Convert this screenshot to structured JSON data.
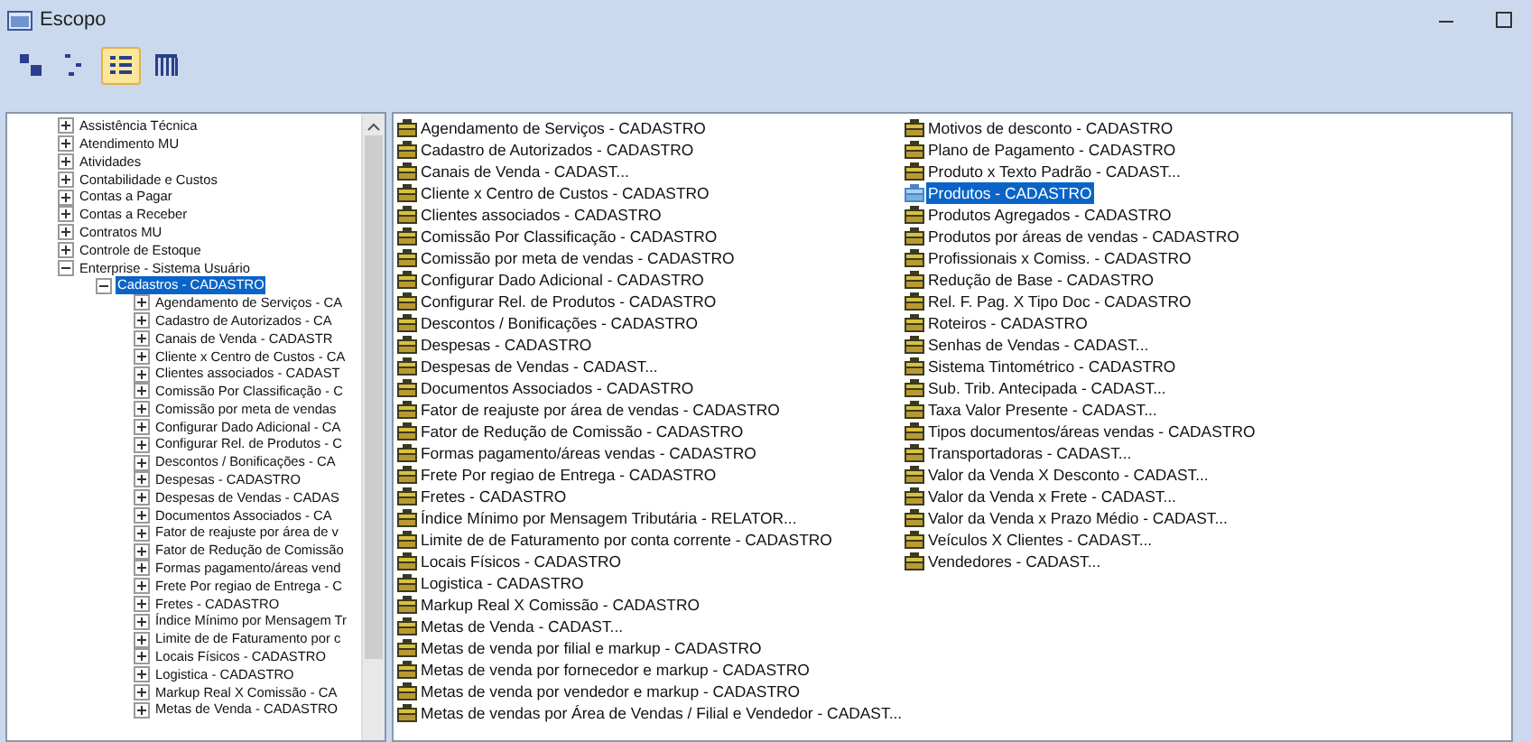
{
  "window": {
    "title": "Escopo"
  },
  "toolbar": [
    {
      "kind": "large-icons",
      "selected": false
    },
    {
      "kind": "small-icons",
      "selected": false
    },
    {
      "kind": "list",
      "selected": true
    },
    {
      "kind": "details",
      "selected": false
    }
  ],
  "tree": [
    {
      "label": "Assistência Técnica",
      "expanded": false,
      "selected": false
    },
    {
      "label": "Atendimento MU",
      "expanded": false,
      "selected": false
    },
    {
      "label": "Atividades",
      "expanded": false,
      "selected": false
    },
    {
      "label": "Contabilidade e Custos",
      "expanded": false,
      "selected": false
    },
    {
      "label": "Contas a Pagar",
      "expanded": false,
      "selected": false
    },
    {
      "label": "Contas a Receber",
      "expanded": false,
      "selected": false
    },
    {
      "label": "Contratos MU",
      "expanded": false,
      "selected": false
    },
    {
      "label": "Controle de Estoque",
      "expanded": false,
      "selected": false
    },
    {
      "label": "Enterprise - Sistema Usuário",
      "expanded": true,
      "selected": false,
      "children": [
        {
          "label": "Cadastros - CADASTRO",
          "expanded": true,
          "selected": true,
          "children": [
            {
              "label": "Agendamento de Serviços - CA",
              "expanded": false,
              "selected": false
            },
            {
              "label": "Cadastro de Autorizados - CA",
              "expanded": false,
              "selected": false
            },
            {
              "label": "Canais de Venda - CADASTR",
              "expanded": false,
              "selected": false
            },
            {
              "label": "Cliente x Centro de Custos - CA",
              "expanded": false,
              "selected": false
            },
            {
              "label": "Clientes associados - CADAST",
              "expanded": false,
              "selected": false
            },
            {
              "label": "Comissão Por Classificação - C",
              "expanded": false,
              "selected": false
            },
            {
              "label": "Comissão por meta de vendas",
              "expanded": false,
              "selected": false
            },
            {
              "label": "Configurar Dado Adicional - CA",
              "expanded": false,
              "selected": false
            },
            {
              "label": "Configurar Rel. de Produtos - C",
              "expanded": false,
              "selected": false
            },
            {
              "label": "Descontos / Bonificações - CA",
              "expanded": false,
              "selected": false
            },
            {
              "label": "Despesas - CADASTRO",
              "expanded": false,
              "selected": false
            },
            {
              "label": "Despesas de Vendas - CADAS",
              "expanded": false,
              "selected": false
            },
            {
              "label": "Documentos Associados - CA",
              "expanded": false,
              "selected": false
            },
            {
              "label": "Fator de reajuste por área de v",
              "expanded": false,
              "selected": false
            },
            {
              "label": "Fator de Redução de Comissão",
              "expanded": false,
              "selected": false
            },
            {
              "label": "Formas pagamento/áreas vend",
              "expanded": false,
              "selected": false
            },
            {
              "label": "Frete Por regiao de Entrega - C",
              "expanded": false,
              "selected": false
            },
            {
              "label": "Fretes - CADASTRO",
              "expanded": false,
              "selected": false
            },
            {
              "label": "Índice Mínimo por Mensagem Tr",
              "expanded": false,
              "selected": false
            },
            {
              "label": "Limite de de Faturamento por c",
              "expanded": false,
              "selected": false
            },
            {
              "label": "Locais Físicos - CADASTRO",
              "expanded": false,
              "selected": false
            },
            {
              "label": "Logistica - CADASTRO",
              "expanded": false,
              "selected": false
            },
            {
              "label": "Markup Real X Comissão - CA",
              "expanded": false,
              "selected": false
            },
            {
              "label": "Metas de Venda - CADASTRO",
              "expanded": false,
              "selected": false
            }
          ]
        }
      ]
    }
  ],
  "items": [
    {
      "label": "Agendamento de Serviços - CADASTRO",
      "selected": false
    },
    {
      "label": "Cadastro de Autorizados - CADASTRO",
      "selected": false
    },
    {
      "label": "Canais de Venda - CADAST...",
      "selected": false
    },
    {
      "label": "Cliente x Centro de Custos - CADASTRO",
      "selected": false
    },
    {
      "label": "Clientes associados - CADASTRO",
      "selected": false
    },
    {
      "label": "Comissão Por Classificação - CADASTRO",
      "selected": false
    },
    {
      "label": "Comissão por meta de vendas - CADASTRO",
      "selected": false
    },
    {
      "label": "Configurar Dado Adicional - CADASTRO",
      "selected": false
    },
    {
      "label": "Configurar Rel. de Produtos - CADASTRO",
      "selected": false
    },
    {
      "label": "Descontos / Bonificações - CADASTRO",
      "selected": false
    },
    {
      "label": "Despesas - CADASTRO",
      "selected": false
    },
    {
      "label": "Despesas de Vendas - CADAST...",
      "selected": false
    },
    {
      "label": "Documentos Associados - CADASTRO",
      "selected": false
    },
    {
      "label": "Fator de reajuste por área de vendas - CADASTRO",
      "selected": false
    },
    {
      "label": "Fator de Redução de Comissão - CADASTRO",
      "selected": false
    },
    {
      "label": "Formas pagamento/áreas vendas - CADASTRO",
      "selected": false
    },
    {
      "label": "Frete Por regiao de Entrega - CADASTRO",
      "selected": false
    },
    {
      "label": "Fretes - CADASTRO",
      "selected": false
    },
    {
      "label": "Índice Mínimo por Mensagem Tributária - RELATOR...",
      "selected": false
    },
    {
      "label": "Limite de de Faturamento por conta corrente - CADASTRO",
      "selected": false
    },
    {
      "label": "Locais Físicos - CADASTRO",
      "selected": false
    },
    {
      "label": "Logistica - CADASTRO",
      "selected": false
    },
    {
      "label": "Markup Real X Comissão - CADASTRO",
      "selected": false
    },
    {
      "label": "Metas de Venda - CADAST...",
      "selected": false
    },
    {
      "label": "Metas de venda por filial e markup - CADASTRO",
      "selected": false
    },
    {
      "label": "Metas de venda por fornecedor e markup - CADASTRO",
      "selected": false
    },
    {
      "label": "Metas de venda por vendedor e markup - CADASTRO",
      "selected": false
    },
    {
      "label": "Metas de vendas por Área de Vendas / Filial e Vendedor - CADAST...",
      "selected": false
    },
    {
      "label": "Motivos de desconto - CADASTRO",
      "selected": false
    },
    {
      "label": "Plano de Pagamento - CADASTRO",
      "selected": false
    },
    {
      "label": "Produto x Texto Padrão - CADAST...",
      "selected": false
    },
    {
      "label": "Produtos - CADASTRO",
      "selected": true
    },
    {
      "label": "Produtos Agregados - CADASTRO",
      "selected": false
    },
    {
      "label": "Produtos por áreas de vendas - CADASTRO",
      "selected": false
    },
    {
      "label": "Profissionais x Comiss. - CADASTRO",
      "selected": false
    },
    {
      "label": "Redução de Base - CADASTRO",
      "selected": false
    },
    {
      "label": "Rel. F. Pag. X Tipo Doc - CADASTRO",
      "selected": false
    },
    {
      "label": "Roteiros - CADASTRO",
      "selected": false
    },
    {
      "label": "Senhas de Vendas - CADAST...",
      "selected": false
    },
    {
      "label": "Sistema Tintométrico - CADASTRO",
      "selected": false
    },
    {
      "label": "Sub. Trib. Antecipada - CADAST...",
      "selected": false
    },
    {
      "label": "Taxa Valor Presente - CADAST...",
      "selected": false
    },
    {
      "label": "Tipos documentos/áreas vendas - CADASTRO",
      "selected": false
    },
    {
      "label": "Transportadoras - CADAST...",
      "selected": false
    },
    {
      "label": "Valor da Venda X Desconto - CADAST...",
      "selected": false
    },
    {
      "label": "Valor da Venda x Frete - CADAST...",
      "selected": false
    },
    {
      "label": "Valor da Venda x Prazo Médio - CADAST...",
      "selected": false
    },
    {
      "label": "Veículos X Clientes - CADAST...",
      "selected": false
    },
    {
      "label": "Vendedores - CADAST...",
      "selected": false
    }
  ]
}
